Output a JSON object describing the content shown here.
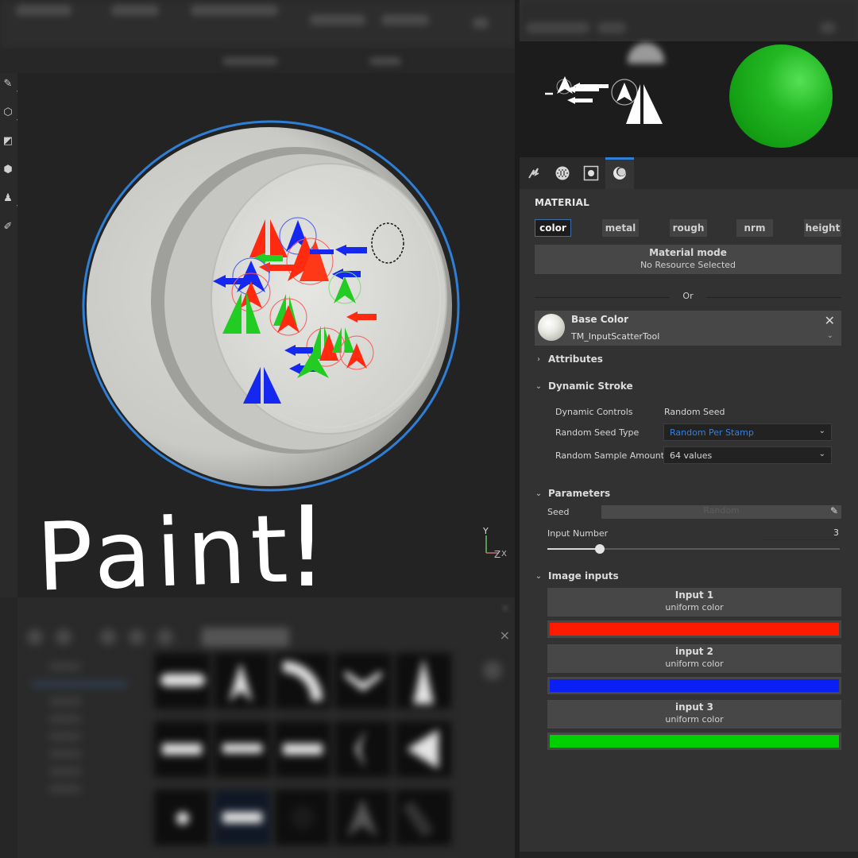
{
  "viewport": {
    "overlay_text": "Paint",
    "overlay_bang": "!",
    "axis_labels": {
      "y": "Y",
      "z": "Z",
      "x": "X"
    }
  },
  "left_toolbar": {
    "tools": [
      {
        "icon": "brush-icon",
        "glyph": "✎",
        "has_menu": true
      },
      {
        "icon": "cube-icon",
        "glyph": "⬡",
        "has_menu": true
      },
      {
        "icon": "projection-icon",
        "glyph": "◩",
        "has_menu": false
      },
      {
        "icon": "eraser-icon",
        "glyph": "⬢",
        "has_menu": false
      },
      {
        "icon": "clone-stamp-icon",
        "glyph": "♟",
        "has_menu": true
      },
      {
        "icon": "picker-icon",
        "glyph": "✐",
        "has_menu": false
      }
    ]
  },
  "shelf": {
    "close_glyph": "×"
  },
  "right_panel": {
    "preview_sphere_color": "#1fb31f",
    "icon_tabs": [
      {
        "name": "brush-settings-tab",
        "icon": "brush-stroke-icon",
        "active": false
      },
      {
        "name": "alpha-tab",
        "icon": "alpha-dots-icon",
        "active": false
      },
      {
        "name": "stencil-tab",
        "icon": "stencil-icon",
        "active": false
      },
      {
        "name": "material-tab",
        "icon": "material-sphere-icon",
        "active": true
      }
    ],
    "material": {
      "title": "MATERIAL",
      "channels": [
        {
          "label": "color",
          "active": true
        },
        {
          "label": "metal",
          "active": false
        },
        {
          "label": "rough",
          "active": false
        },
        {
          "label": "nrm",
          "active": false
        },
        {
          "label": "height",
          "active": false
        }
      ],
      "mode_title": "Material mode",
      "mode_sub": "No Resource Selected",
      "or_label": "Or",
      "base_color": {
        "title": "Base Color",
        "resource": "TM_InputScatterTool"
      }
    },
    "attributes": {
      "label": "Attributes",
      "expanded": false
    },
    "dynamic_stroke": {
      "label": "Dynamic Stroke",
      "expanded": true,
      "controls_label": "Dynamic Controls",
      "controls_value": "Random Seed",
      "seed_type_label": "Random Seed Type",
      "seed_type_value": "Random Per Stamp",
      "sample_amount_label": "Random Sample Amount",
      "sample_amount_value": "64 values"
    },
    "parameters": {
      "label": "Parameters",
      "expanded": true,
      "seed_label": "Seed",
      "seed_value": "Random",
      "input_number_label": "Input Number",
      "input_number_value": "3",
      "input_number_fraction": 0.18
    },
    "image_inputs": {
      "label": "Image inputs",
      "expanded": true,
      "items": [
        {
          "title": "Input 1",
          "sub": "uniform color",
          "color": "#ff1a00"
        },
        {
          "title": "input 2",
          "sub": "uniform color",
          "color": "#0a1ff5"
        },
        {
          "title": "input 3",
          "sub": "uniform color",
          "color": "#00d000"
        }
      ]
    }
  }
}
